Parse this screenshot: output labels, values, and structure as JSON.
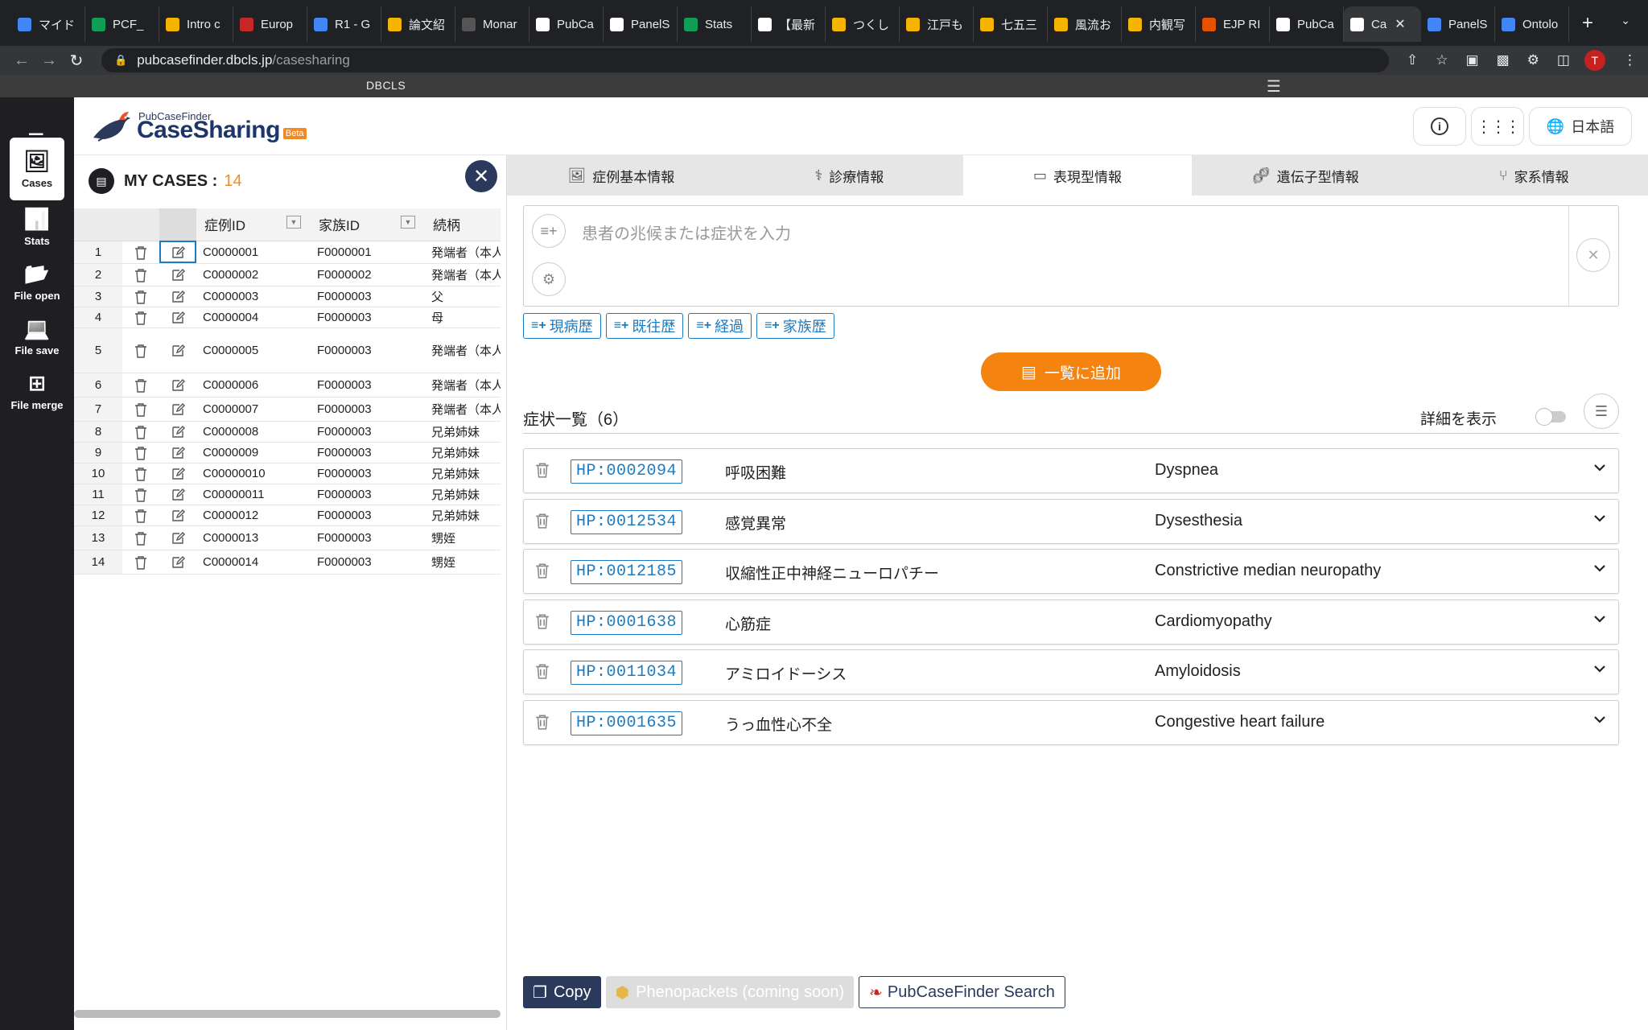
{
  "browser": {
    "tabs": [
      {
        "label": "マイド",
        "color": "#4285f4"
      },
      {
        "label": "PCF_",
        "color": "#0f9d58"
      },
      {
        "label": "Intro c",
        "color": "#f4b400"
      },
      {
        "label": "Europ",
        "color": "#c62828"
      },
      {
        "label": "R1 - G",
        "color": "#4285f4"
      },
      {
        "label": "論文紹",
        "color": "#f4b400"
      },
      {
        "label": "Monar",
        "color": "#555555"
      },
      {
        "label": "PubCa",
        "color": "#ffffff"
      },
      {
        "label": "PanelS",
        "color": "#ffffff"
      },
      {
        "label": "Stats",
        "color": "#0f9d58"
      },
      {
        "label": "【最新",
        "color": "#ffffff"
      },
      {
        "label": "つくし",
        "color": "#f4b400"
      },
      {
        "label": "江戸も",
        "color": "#f4b400"
      },
      {
        "label": "七五三",
        "color": "#f4b400"
      },
      {
        "label": "風流お",
        "color": "#f4b400"
      },
      {
        "label": "内観写",
        "color": "#f4b400"
      },
      {
        "label": "EJP RI",
        "color": "#e65100"
      },
      {
        "label": "PubCa",
        "color": "#ffffff"
      },
      {
        "label": "Ca",
        "color": "#ffffff",
        "active": true
      },
      {
        "label": "PanelS",
        "color": "#4285f4"
      },
      {
        "label": "Ontolo",
        "color": "#4285f4"
      }
    ],
    "url_host": "pubcasefinder.dbcls.jp",
    "url_path": "/casesharing",
    "profile_initial": "T",
    "strip_label": "DBCLS"
  },
  "nav": {
    "items": [
      {
        "label": "Cases",
        "icon": "cases-icon",
        "active": true
      },
      {
        "label": "Stats",
        "icon": "stats-icon"
      },
      {
        "label": "File open",
        "icon": "folder-open-icon"
      },
      {
        "label": "File save",
        "icon": "file-save-icon"
      },
      {
        "label": "File merge",
        "icon": "file-merge-icon"
      }
    ]
  },
  "header": {
    "logo_small": "PubCaseFinder",
    "logo_big": "CaseSharing",
    "logo_badge": "Beta",
    "language": "日本語"
  },
  "cases": {
    "title": "MY CASES :",
    "count": "14",
    "columns": [
      "症例ID",
      "家族ID",
      "続柄"
    ],
    "rows": [
      {
        "n": "1",
        "id": "C0000001",
        "fam": "F0000001",
        "rel": "発端者（本人）"
      },
      {
        "n": "2",
        "id": "C0000002",
        "fam": "F0000002",
        "rel": "発端者（本人）"
      },
      {
        "n": "3",
        "id": "C0000003",
        "fam": "F0000003",
        "rel": "父"
      },
      {
        "n": "4",
        "id": "C0000004",
        "fam": "F0000003",
        "rel": "母"
      },
      {
        "n": "5",
        "id": "C0000005",
        "fam": "F0000003",
        "rel": "発端者（本人）"
      },
      {
        "n": "6",
        "id": "C0000006",
        "fam": "F0000003",
        "rel": "発端者（本人）"
      },
      {
        "n": "7",
        "id": "C0000007",
        "fam": "F0000003",
        "rel": "発端者（本人）"
      },
      {
        "n": "8",
        "id": "C0000008",
        "fam": "F0000003",
        "rel": "兄弟姉妹"
      },
      {
        "n": "9",
        "id": "C0000009",
        "fam": "F0000003",
        "rel": "兄弟姉妹"
      },
      {
        "n": "10",
        "id": "C00000010",
        "fam": "F0000003",
        "rel": "兄弟姉妹"
      },
      {
        "n": "11",
        "id": "C00000011",
        "fam": "F0000003",
        "rel": "兄弟姉妹"
      },
      {
        "n": "12",
        "id": "C0000012",
        "fam": "F0000003",
        "rel": "兄弟姉妹"
      },
      {
        "n": "13",
        "id": "C0000013",
        "fam": "F0000003",
        "rel": "甥姪"
      },
      {
        "n": "14",
        "id": "C0000014",
        "fam": "F0000003",
        "rel": "甥姪"
      }
    ]
  },
  "tabs": [
    {
      "label": "症例基本情報",
      "icon": "person-card-icon"
    },
    {
      "label": "診療情報",
      "icon": "stethoscope-icon"
    },
    {
      "label": "表現型情報",
      "icon": "phenotype-icon",
      "active": true
    },
    {
      "label": "遺伝子型情報",
      "icon": "dna-icon"
    },
    {
      "label": "家系情報",
      "icon": "pedigree-icon"
    }
  ],
  "phenotype": {
    "placeholder": "患者の兆候または症状を入力",
    "history_buttons": [
      "現病歴",
      "既往歴",
      "経過",
      "家族歴"
    ],
    "add_button": "一覧に追加",
    "list_title": "症状一覧（6）",
    "detail_toggle_label": "詳細を表示",
    "symptoms": [
      {
        "hpo": "HP:0002094",
        "ja": "呼吸困難",
        "en": "Dyspnea"
      },
      {
        "hpo": "HP:0012534",
        "ja": "感覚異常",
        "en": "Dysesthesia"
      },
      {
        "hpo": "HP:0012185",
        "ja": "収縮性正中神経ニューロパチー",
        "en": "Constrictive median neuropathy"
      },
      {
        "hpo": "HP:0001638",
        "ja": "心筋症",
        "en": "Cardiomyopathy"
      },
      {
        "hpo": "HP:0011034",
        "ja": "アミロイドーシス",
        "en": "Amyloidosis"
      },
      {
        "hpo": "HP:0001635",
        "ja": "うっ血性心不全",
        "en": "Congestive heart failure"
      }
    ]
  },
  "footer": {
    "copy": "Copy",
    "phenopackets": "Phenopackets (coming soon)",
    "pcf_search": "PubCaseFinder Search"
  }
}
